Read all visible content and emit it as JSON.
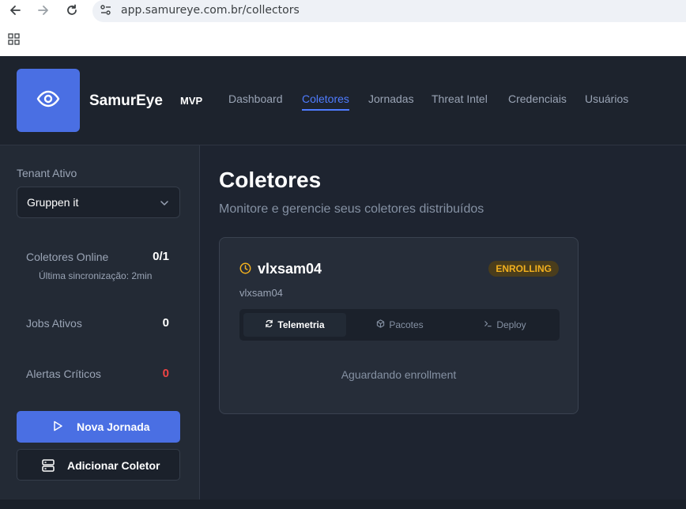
{
  "browser": {
    "url": "app.samureye.com.br/collectors"
  },
  "header": {
    "brand": "SamurEye",
    "edition": "MVP",
    "nav": [
      {
        "label": "Dashboard",
        "active": false
      },
      {
        "label": "Coletores",
        "active": true
      },
      {
        "label": "Jornadas",
        "active": false
      },
      {
        "label": "Threat Intel",
        "active": false
      },
      {
        "label": "Credenciais",
        "active": false
      },
      {
        "label": "Usuários",
        "active": false
      }
    ]
  },
  "sidebar": {
    "tenant_label": "Tenant Ativo",
    "tenant_value": "Gruppen it",
    "stats": {
      "collectors_label": "Coletores Online",
      "collectors_value": "0/1",
      "last_sync": "Última sincronização: 2min",
      "jobs_label": "Jobs Ativos",
      "jobs_value": "0",
      "alerts_label": "Alertas Críticos",
      "alerts_value": "0"
    },
    "primary_button": "Nova Jornada",
    "secondary_button": "Adicionar Coletor"
  },
  "main": {
    "title": "Coletores",
    "subtitle": "Monitore e gerencie seus coletores distribuídos",
    "collector": {
      "name": "vlxsam04",
      "hostname": "vlxsam04",
      "status": "ENROLLING",
      "tabs": [
        "Telemetria",
        "Pacotes",
        "Deploy"
      ],
      "active_tab": "Telemetria",
      "empty_message": "Aguardando enrollment"
    }
  },
  "colors": {
    "accent": "#4f7cff",
    "primary_button": "#4a6fe3",
    "status_warning": "#f2b01e",
    "alert": "#ef4444"
  }
}
